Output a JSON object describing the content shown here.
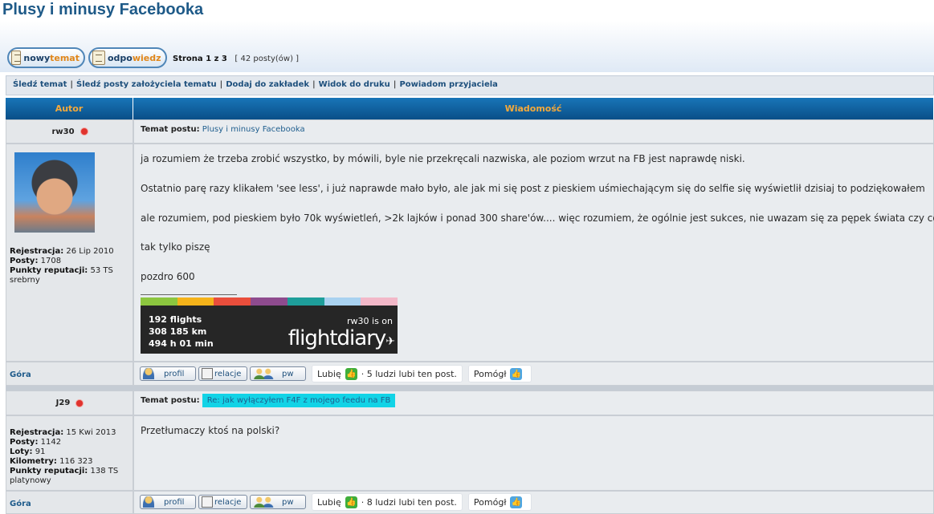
{
  "page": {
    "title": "Plusy i minusy Facebooka"
  },
  "actions": {
    "new_topic": {
      "part1": "nowy ",
      "part2": "temat"
    },
    "reply": {
      "part1": "odpo",
      "part2": "wiedz"
    }
  },
  "pager": {
    "page": "Strona 1 z 3",
    "count": "[ 42 posty(ów) ]"
  },
  "toolbar": {
    "items": [
      "Śledź temat",
      "Śledź posty założyciela tematu",
      "Dodaj do zakładek",
      "Widok do druku",
      "Powiadom przyjaciela"
    ]
  },
  "table": {
    "author_header": "Autor",
    "message_header": "Wiadomość"
  },
  "posts": [
    {
      "author": "rw30",
      "subject_label": "Temat postu:",
      "subject": "Plusy i minusy Facebooka",
      "stats": [
        {
          "label": "Rejestracja:",
          "value": "26 Lip 2010"
        },
        {
          "label": "Posty:",
          "value": "1708"
        },
        {
          "label": "Punkty reputacji:",
          "value": "53 TS"
        }
      ],
      "rank": "srebrny",
      "body": [
        "ja rozumiem że trzeba zrobić wszystko, by mówili, byle nie przekręcali nazwiska, ale poziom wrzut na FB jest naprawdę niski.",
        "Ostatnio parę razy klikałem 'see less', i już naprawde mało było, ale jak mi się post z pieskiem uśmiechającym się do selfie się wyświetlił dzisiaj to podziękowałem",
        "ale rozumiem, pod pieskiem było 70k wyświetleń, >2k lajków i ponad 300 share'ów.... więc rozumiem, że ogólnie jest sukces, nie uwazam się za pępek świata czy coś",
        "tak tylko piszę",
        "pozdro 600"
      ],
      "signature": {
        "flights": "192 flights",
        "km": "308 185 km",
        "time": "494 h 01 min",
        "on": "rw30 is on",
        "logo": "flightdiary",
        "colors": [
          "#8cc63f",
          "#f5b31a",
          "#e94e3c",
          "#8e4b8e",
          "#1e9e9a",
          "#a9d2f0",
          "#f2b8c8"
        ]
      },
      "top_link": "Góra",
      "buttons": {
        "profile": "profil",
        "relations": "relacje",
        "pm": "pw"
      },
      "like": {
        "label": "Lubię",
        "count": "· 5 ludzi lubi ten post."
      },
      "helped": "Pomógł"
    },
    {
      "author": "J29",
      "subject_label": "Temat postu:",
      "subject": "Re: jak wyłączyłem F4F z mojego feedu na FB",
      "stats": [
        {
          "label": "Rejestracja:",
          "value": "15 Kwi 2013"
        },
        {
          "label": "Posty:",
          "value": "1142"
        },
        {
          "label": "Loty:",
          "value": "91"
        },
        {
          "label": "Kilometry:",
          "value": "116 323"
        },
        {
          "label": "Punkty reputacji:",
          "value": "138 TS"
        }
      ],
      "rank": "platynowy",
      "body": [
        "Przetłumaczy ktoś na polski?"
      ],
      "top_link": "Góra",
      "buttons": {
        "profile": "profil",
        "relations": "relacje",
        "pm": "pw"
      },
      "like": {
        "label": "Lubię",
        "count": "· 8 ludzi lubi ten post."
      },
      "helped": "Pomógł"
    }
  ]
}
